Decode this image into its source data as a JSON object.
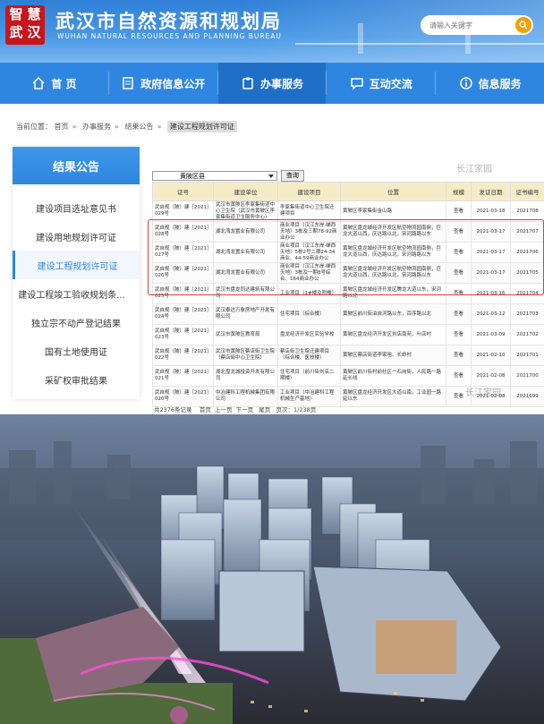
{
  "header": {
    "logo_seal_chars": [
      "智",
      "慧",
      "武",
      "汉"
    ],
    "site_title": "武汉市自然资源和规划局",
    "site_subtitle": "WUHAN NATURAL RESOURCES AND PLANNING BUREAU",
    "search_placeholder": "请输入关键字",
    "search_icon": "magnifier-icon"
  },
  "nav": {
    "items": [
      {
        "label": "首 页",
        "icon": "home-icon"
      },
      {
        "label": "政府信息公开",
        "icon": "document-icon"
      },
      {
        "label": "办事服务",
        "icon": "service-icon",
        "active": true
      },
      {
        "label": "互动交流",
        "icon": "chat-icon"
      },
      {
        "label": "信息服务",
        "icon": "info-icon"
      }
    ]
  },
  "breadcrumb": {
    "prefix": "当前位置：",
    "items": [
      "首页",
      "办事服务",
      "结果公告"
    ],
    "current": "建设工程规划许可证",
    "separator": "»"
  },
  "sidebar": {
    "title": "结果公告",
    "items": [
      {
        "label": "建设项目选址意见书"
      },
      {
        "label": "建设用地规划许可证"
      },
      {
        "label": "建设工程规划许可证",
        "active": true
      },
      {
        "label": "建设工程竣工验收规划条..."
      },
      {
        "label": "独立宗不动产登记结果"
      },
      {
        "label": "国有土地使用证"
      },
      {
        "label": "采矿权审批结果"
      }
    ]
  },
  "filter": {
    "district": "黄陂区县",
    "query_button": "查询"
  },
  "table": {
    "columns": [
      "证号",
      "建设单位",
      "建设项目",
      "位置",
      "规模",
      "发证日期",
      "证书编号"
    ],
    "rows": [
      [
        "武自规（陂）建［2021］029号",
        "武汉市黄陂区李家集街道中心卫生院（武汉市黄陂区李家集街道卫生服务中心）",
        "李家集街道中心卫生院迁建项目",
        "黄陂区李家集街金山路",
        "查看",
        "2021-03-18",
        "2021708"
      ],
      [
        "武自规（陂）建［2021］028号",
        "湖北湾龙置业有限公司",
        "商业项目（汉江东岸·嵊西天地）3栋及三期78-92商业办公",
        "黄陂区盘龙城经济开发区航空物流园南侧，巨龙大道以西，庆达路以北，宋河路路以东",
        "查看",
        "2021-03-17",
        "2021707"
      ],
      [
        "武自规（陂）建［2021］027号",
        "湖北湾龙置业有限公司",
        "商业项目（汉江东岸·嵊西天地）5栋2号二期24-34商业、44-59商业办公",
        "黄陂区盘龙城经济开发区航空物流园南侧，巨龙大道以西，庆达路以北，宋河路路以东",
        "查看",
        "2021-03-17",
        "2021706"
      ],
      [
        "武自规（陂）建［2021］026号",
        "湖北湾龙置业有限公司",
        "商业项目（汉江东岸·嵊西天地）3栋及一期8号综合、164商业办公",
        "黄陂区盘龙城经济开发区航空物流园南侧，巨龙大道以西，庆达路以北，宋河路路以东",
        "查看",
        "2021-03-17",
        "2021705"
      ],
      [
        "武自规（陂）建［2021］025号",
        "武汉市盘龙同达建筑有限公司",
        "工业项目（1#楼及附楼）",
        "黄陂区盘龙城经济开发区腾龙大道以东，宋河路以北",
        "查看",
        "2021-03-16",
        "2021704"
      ],
      [
        "武自规（陂）建［2021］024号",
        "武汉泰达万象房地产开发有限公司",
        "住宅项目（综合楼）",
        "黄陂区前川街泊自河路以东，百序路以北",
        "查看",
        "2021-03-12",
        "2021703"
      ],
      [
        "武自规（陂）建［2021］023号",
        "武汉市黄陂区教育局",
        "盘龙经济开发区实验学校",
        "黄陂区盘龙经济开发区刘店南苑，叶店村",
        "查看",
        "2021-03-09",
        "2021702"
      ],
      [
        "武自规（陂）建［2021］022号",
        "武汉市黄陂区蔡店街卫生院（蔡店街中心卫生院）",
        "蔡店街卫生院迁建项目（综合楼、医技楼）",
        "黄陂区蔡店街道李家咀、长岭村",
        "查看",
        "2021-02-10",
        "2021701"
      ],
      [
        "武自规（陂）建［2021］021号",
        "湖北盘龙城投资开发有限公司",
        "住宅项目（前川街刘店二期楼）",
        "黄陂区前川街村前社区一石岗街，人民路一路延长线",
        "查看",
        "2021-02-08",
        "2021700"
      ],
      [
        "武自规（陂）建［2021］020号",
        "中冶建科工程机械集团有限公司",
        "工业项目（中冶建科工程机械生产基地）",
        "黄陂区盘龙经济开发区大道以南，工业园一路延以东",
        "查看",
        "2021-02-08",
        "2021699"
      ]
    ]
  },
  "pagination": {
    "summary": "共2376条记录",
    "first": "首页",
    "prev": "上一页",
    "next": "下一页",
    "last": "尾页",
    "page_info": "页次：1/238页"
  },
  "watermarks": [
    "长江家园",
    "长江家园"
  ],
  "colors": {
    "primary_blue": "#2f86e0",
    "header_red_seal": "#c8161d",
    "search_button": "#f2a100",
    "table_header": "#f5ecc7",
    "highlight_box": "#e23b3b"
  }
}
